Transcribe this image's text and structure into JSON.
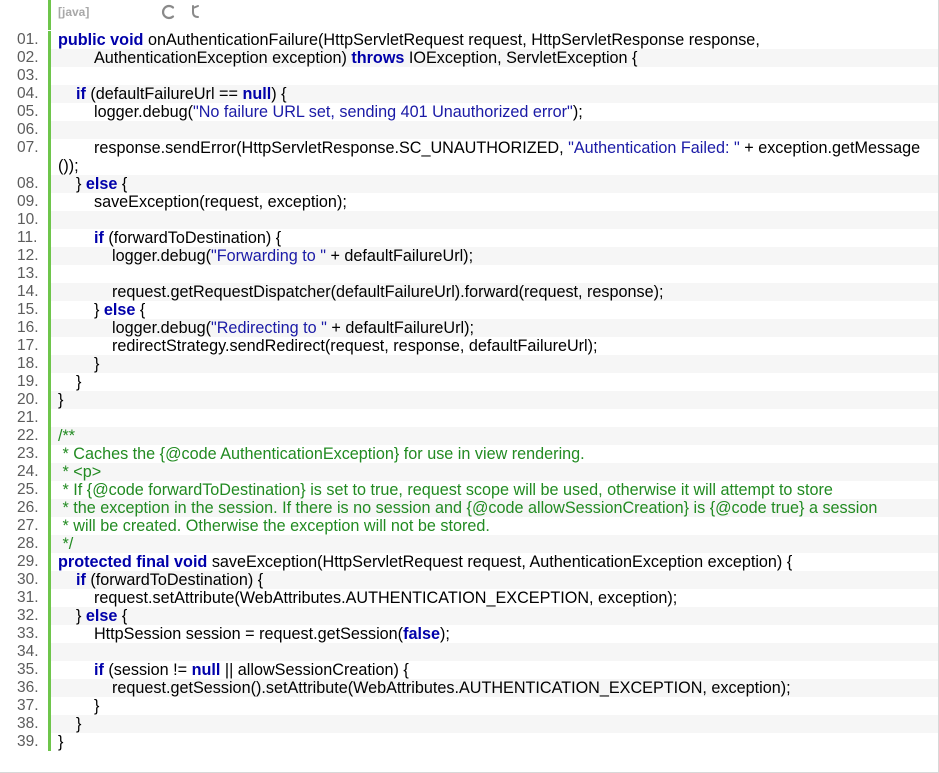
{
  "toolbar": {
    "language": "[java]",
    "copy_icon": "copy-icon",
    "source_icon": "view-source-icon"
  },
  "colors": {
    "gutter_bar": "#6ec54b",
    "keyword": "#0000aa",
    "string": "#1a1aa6",
    "comment": "#228b22",
    "alt_row": "#f6f6f6"
  },
  "code_lines": [
    {
      "num": "01.",
      "tokens": [
        [
          "kw",
          "public"
        ],
        [
          "t",
          " "
        ],
        [
          "kw",
          "void"
        ],
        [
          "t",
          " onAuthenticationFailure(HttpServletRequest request, HttpServletResponse response,"
        ]
      ]
    },
    {
      "num": "02.",
      "tokens": [
        [
          "t",
          "        AuthenticationException exception) "
        ],
        [
          "kw",
          "throws"
        ],
        [
          "t",
          " IOException, ServletException {"
        ]
      ]
    },
    {
      "num": "03.",
      "tokens": []
    },
    {
      "num": "04.",
      "tokens": [
        [
          "t",
          "    "
        ],
        [
          "kw",
          "if"
        ],
        [
          "t",
          " (defaultFailureUrl == "
        ],
        [
          "kw",
          "null"
        ],
        [
          "t",
          ") {"
        ]
      ]
    },
    {
      "num": "05.",
      "tokens": [
        [
          "t",
          "        logger.debug("
        ],
        [
          "str",
          "\"No failure URL set, sending 401 Unauthorized error\""
        ],
        [
          "t",
          ");"
        ]
      ]
    },
    {
      "num": "06.",
      "tokens": []
    },
    {
      "num": "07.",
      "tokens": [
        [
          "t",
          "        response.sendError(HttpServletResponse.SC_UNAUTHORIZED, "
        ],
        [
          "str",
          "\"Authentication Failed: \""
        ],
        [
          "t",
          " + exception.getMessage());"
        ]
      ]
    },
    {
      "num": "08.",
      "tokens": [
        [
          "t",
          "    } "
        ],
        [
          "kw",
          "else"
        ],
        [
          "t",
          " {"
        ]
      ]
    },
    {
      "num": "09.",
      "tokens": [
        [
          "t",
          "        saveException(request, exception);"
        ]
      ]
    },
    {
      "num": "10.",
      "tokens": []
    },
    {
      "num": "11.",
      "tokens": [
        [
          "t",
          "        "
        ],
        [
          "kw",
          "if"
        ],
        [
          "t",
          " (forwardToDestination) {"
        ]
      ]
    },
    {
      "num": "12.",
      "tokens": [
        [
          "t",
          "            logger.debug("
        ],
        [
          "str",
          "\"Forwarding to \""
        ],
        [
          "t",
          " + defaultFailureUrl);"
        ]
      ]
    },
    {
      "num": "13.",
      "tokens": []
    },
    {
      "num": "14.",
      "tokens": [
        [
          "t",
          "            request.getRequestDispatcher(defaultFailureUrl).forward(request, response);"
        ]
      ]
    },
    {
      "num": "15.",
      "tokens": [
        [
          "t",
          "        } "
        ],
        [
          "kw",
          "else"
        ],
        [
          "t",
          " {"
        ]
      ]
    },
    {
      "num": "16.",
      "tokens": [
        [
          "t",
          "            logger.debug("
        ],
        [
          "str",
          "\"Redirecting to \""
        ],
        [
          "t",
          " + defaultFailureUrl);"
        ]
      ]
    },
    {
      "num": "17.",
      "tokens": [
        [
          "t",
          "            redirectStrategy.sendRedirect(request, response, defaultFailureUrl);"
        ]
      ]
    },
    {
      "num": "18.",
      "tokens": [
        [
          "t",
          "        }"
        ]
      ]
    },
    {
      "num": "19.",
      "tokens": [
        [
          "t",
          "    }"
        ]
      ]
    },
    {
      "num": "20.",
      "tokens": [
        [
          "t",
          "}"
        ]
      ]
    },
    {
      "num": "21.",
      "tokens": []
    },
    {
      "num": "22.",
      "tokens": [
        [
          "cmt",
          "/**"
        ]
      ]
    },
    {
      "num": "23.",
      "tokens": [
        [
          "cmt",
          " * Caches the {@code AuthenticationException} for use in view rendering."
        ]
      ]
    },
    {
      "num": "24.",
      "tokens": [
        [
          "cmt",
          " * <p>"
        ]
      ]
    },
    {
      "num": "25.",
      "tokens": [
        [
          "cmt",
          " * If {@code forwardToDestination} is set to true, request scope will be used, otherwise it will attempt to store"
        ]
      ]
    },
    {
      "num": "26.",
      "tokens": [
        [
          "cmt",
          " * the exception in the session. If there is no session and {@code allowSessionCreation} is {@code true} a session"
        ]
      ]
    },
    {
      "num": "27.",
      "tokens": [
        [
          "cmt",
          " * will be created. Otherwise the exception will not be stored."
        ]
      ]
    },
    {
      "num": "28.",
      "tokens": [
        [
          "cmt",
          " */"
        ]
      ]
    },
    {
      "num": "29.",
      "tokens": [
        [
          "kw",
          "protected"
        ],
        [
          "t",
          " "
        ],
        [
          "kw",
          "final"
        ],
        [
          "t",
          " "
        ],
        [
          "kw",
          "void"
        ],
        [
          "t",
          " saveException(HttpServletRequest request, AuthenticationException exception) {"
        ]
      ]
    },
    {
      "num": "30.",
      "tokens": [
        [
          "t",
          "    "
        ],
        [
          "kw",
          "if"
        ],
        [
          "t",
          " (forwardToDestination) {"
        ]
      ]
    },
    {
      "num": "31.",
      "tokens": [
        [
          "t",
          "        request.setAttribute(WebAttributes.AUTHENTICATION_EXCEPTION, exception);"
        ]
      ]
    },
    {
      "num": "32.",
      "tokens": [
        [
          "t",
          "    } "
        ],
        [
          "kw",
          "else"
        ],
        [
          "t",
          " {"
        ]
      ]
    },
    {
      "num": "33.",
      "tokens": [
        [
          "t",
          "        HttpSession session = request.getSession("
        ],
        [
          "kw",
          "false"
        ],
        [
          "t",
          ");"
        ]
      ]
    },
    {
      "num": "34.",
      "tokens": []
    },
    {
      "num": "35.",
      "tokens": [
        [
          "t",
          "        "
        ],
        [
          "kw",
          "if"
        ],
        [
          "t",
          " (session != "
        ],
        [
          "kw",
          "null"
        ],
        [
          "t",
          " || allowSessionCreation) {"
        ]
      ]
    },
    {
      "num": "36.",
      "tokens": [
        [
          "t",
          "            request.getSession().setAttribute(WebAttributes.AUTHENTICATION_EXCEPTION, exception);"
        ]
      ]
    },
    {
      "num": "37.",
      "tokens": [
        [
          "t",
          "        }"
        ]
      ]
    },
    {
      "num": "38.",
      "tokens": [
        [
          "t",
          "    }"
        ]
      ]
    },
    {
      "num": "39.",
      "tokens": [
        [
          "t",
          "}"
        ]
      ]
    }
  ]
}
